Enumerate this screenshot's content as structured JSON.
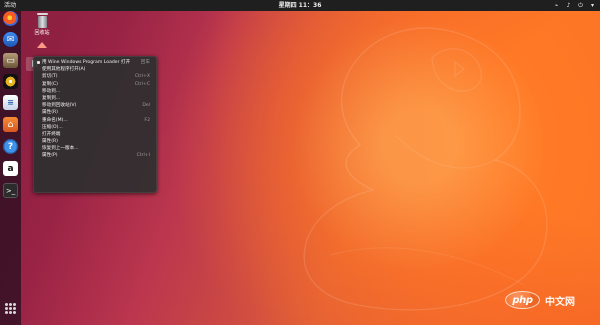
{
  "top_bar": {
    "activities": "活动",
    "clock": "星期四 11：36"
  },
  "dock": {
    "items": [
      {
        "name": "firefox",
        "icon": "firefox-icon"
      },
      {
        "name": "thunderbird",
        "icon": "thunderbird-icon"
      },
      {
        "name": "files",
        "icon": "files-icon"
      },
      {
        "name": "rhythmbox",
        "icon": "rhythmbox-icon"
      },
      {
        "name": "libreoffice-writer",
        "icon": "writer-icon"
      },
      {
        "name": "software",
        "icon": "software-center-icon"
      },
      {
        "name": "help",
        "icon": "help-icon"
      },
      {
        "name": "amazon",
        "icon": "amazon-icon",
        "glyph": "a"
      },
      {
        "name": "terminal",
        "icon": "terminal-icon",
        "glyph": ">_"
      }
    ]
  },
  "desktop": {
    "trash_label": "回收站"
  },
  "context_menu": {
    "items": [
      {
        "label": "用 Wine Windows Program Loader 打开",
        "shortcut": "回车"
      },
      {
        "label": "使用其他程序打开(A)",
        "shortcut": ""
      },
      {
        "label": "剪切(T)",
        "shortcut": "Ctrl+X"
      },
      {
        "label": "复制(C)",
        "shortcut": "Ctrl+C"
      },
      {
        "label": "移动到...",
        "shortcut": ""
      },
      {
        "label": "复制到...",
        "shortcut": ""
      },
      {
        "label": "移动到回收站(V)",
        "shortcut": "Del"
      },
      {
        "label": "属性(R)",
        "shortcut": ""
      },
      {
        "label": "重命名(M)...",
        "shortcut": "F2"
      },
      {
        "label": "压缩(O)...",
        "shortcut": ""
      },
      {
        "label": "打开终端",
        "shortcut": ""
      },
      {
        "label": "属性(R)",
        "shortcut": ""
      },
      {
        "label": "恢复到上一版本...",
        "shortcut": ""
      },
      {
        "label": "属性(P)",
        "shortcut": "Ctrl+I"
      }
    ]
  },
  "watermark": {
    "logo": "php",
    "text": "中文网"
  }
}
